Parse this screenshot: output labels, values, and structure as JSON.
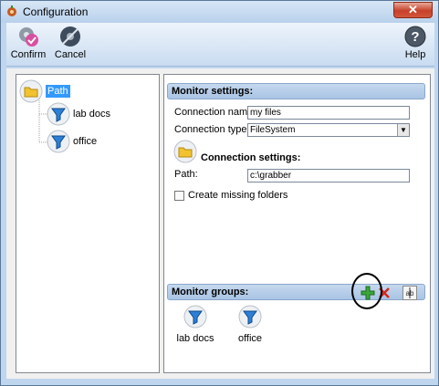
{
  "window": {
    "title": "Configuration",
    "close_glyph": "✕"
  },
  "toolbar": {
    "confirm_label": "Confirm",
    "cancel_label": "Cancel",
    "help_label": "Help"
  },
  "tree": {
    "root_label": "Path",
    "children": [
      "lab docs",
      "office"
    ]
  },
  "monitor_settings": {
    "header": "Monitor settings:",
    "connection_name_label": "Connection name:",
    "connection_name_value": "my files",
    "connection_type_label": "Connection type:",
    "connection_type_value": "FileSystem",
    "connection_settings_header": "Connection settings:",
    "path_label": "Path:",
    "path_value": "c:\\grabber",
    "create_missing_label": "Create missing folders"
  },
  "monitor_groups": {
    "header": "Monitor groups:",
    "items": [
      "lab docs",
      "office"
    ]
  },
  "icons": {
    "app": "gear-icon",
    "confirm": "checkmark-gear-icon",
    "cancel": "cancel-gear-icon",
    "help": "help-icon",
    "folder": "folder-icon",
    "filter": "filter-icon",
    "add": "add-icon",
    "delete": "delete-icon",
    "rename": "rename-icon"
  },
  "colors": {
    "title_bar": "#c9dcf1",
    "header": "#b5cde9",
    "selection": "#3399ff",
    "close": "#c7402a",
    "add_green": "#3aa63a",
    "delete_red": "#d8261c"
  }
}
